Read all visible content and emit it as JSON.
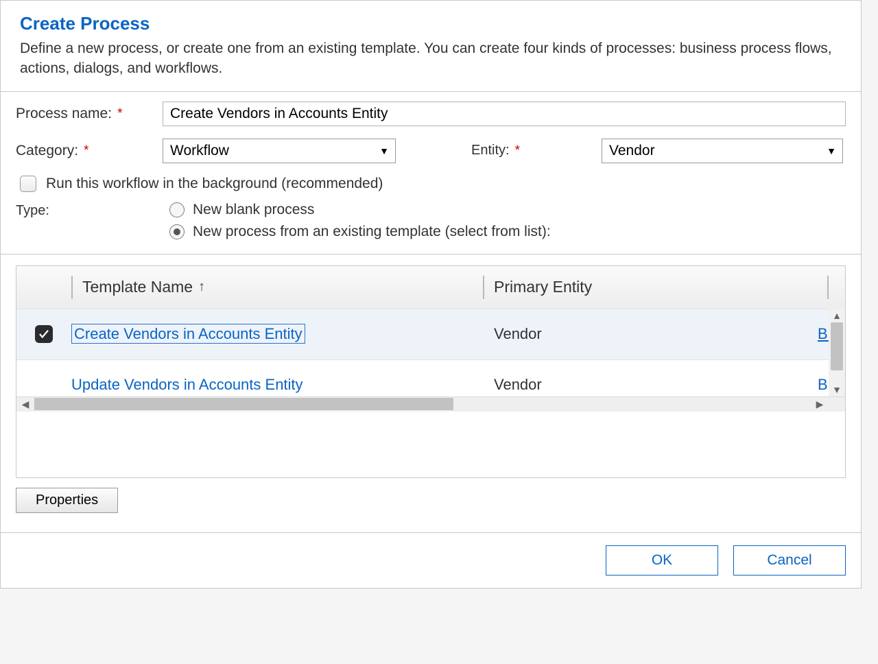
{
  "dialog": {
    "title": "Create Process",
    "description": "Define a new process, or create one from an existing template. You can create four kinds of processes: business process flows, actions, dialogs, and workflows."
  },
  "form": {
    "process_name_label": "Process name:",
    "process_name_value": "Create Vendors in Accounts Entity",
    "category_label": "Category:",
    "category_value": "Workflow",
    "entity_label": "Entity:",
    "entity_value": "Vendor",
    "background_label": "Run this workflow in the background (recommended)",
    "type_label": "Type:",
    "type_blank_label": "New blank process",
    "type_template_label": "New process from an existing template (select from list):"
  },
  "grid": {
    "col_template": "Template Name",
    "col_primary": "Primary Entity",
    "rows": [
      {
        "name": "Create Vendors in Accounts Entity",
        "entity": "Vendor",
        "owner": "Bi",
        "selected": true
      },
      {
        "name": "Update Vendors in Accounts Entity",
        "entity": "Vendor",
        "owner": "Bi",
        "selected": false
      }
    ]
  },
  "buttons": {
    "properties": "Properties",
    "ok": "OK",
    "cancel": "Cancel"
  }
}
